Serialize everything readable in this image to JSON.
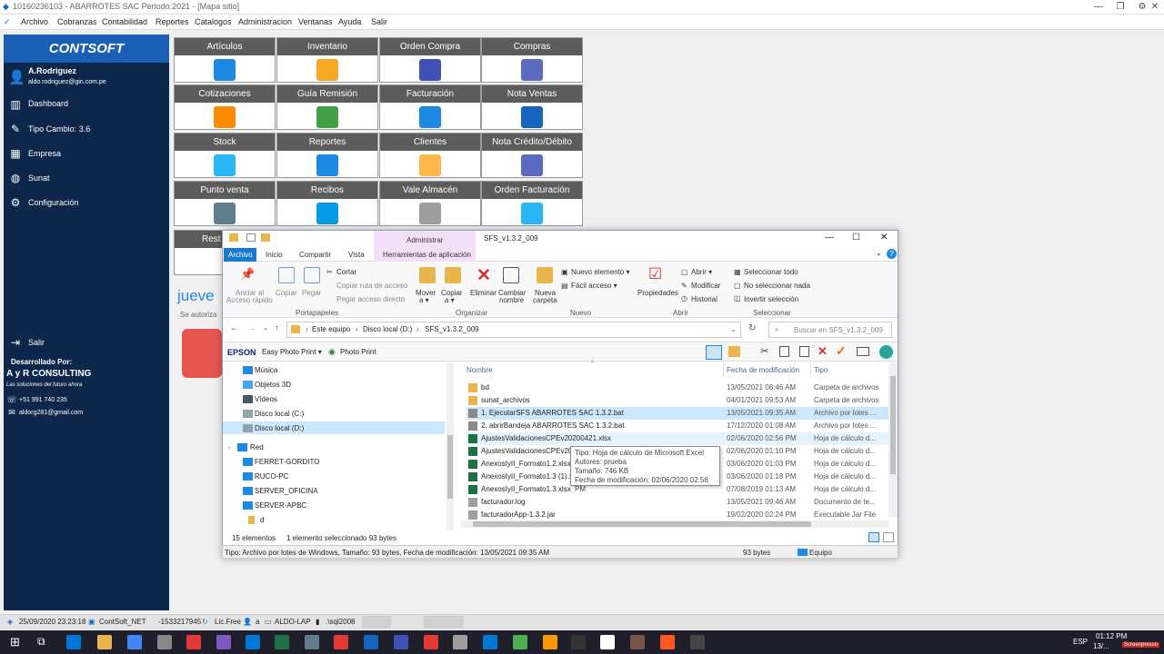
{
  "window": {
    "title": "10160236103 - ABARROTES SAC Periodo:2021 - [Mapa sitio]",
    "controls": [
      "—",
      "❐",
      "⚙",
      "✕"
    ]
  },
  "menu": [
    "Archivo",
    "Cobranzas",
    "Contabilidad",
    "Reportes",
    "Catalogos",
    "Administracion",
    "Ventanas",
    "Ayuda",
    "Salir"
  ],
  "sidebar": {
    "logo": "CONTSOFT",
    "user_name": "A.Rodriguez",
    "user_email": "aldo.rodriguez@gin.com.pe",
    "items": [
      "Dashboard",
      "Tipo Cambio: 3.6",
      "Empresa",
      "Sunat",
      "Configuración"
    ],
    "exit": "Salir",
    "dev_label": "Desarrollado Por:",
    "company": "A y R CONSULTING",
    "slogan": "Las soluciones del futuro ahora",
    "phone": "+51 991 740 235",
    "email": "aldorg281@gmail.com"
  },
  "tiles": [
    {
      "label": "Artículos",
      "color": "#1e88e5"
    },
    {
      "label": "Inventario",
      "color": "#f9a825"
    },
    {
      "label": "Orden Compra",
      "color": "#3f51b5"
    },
    {
      "label": "Compras",
      "color": "#5c6bc0"
    },
    {
      "label": "Cotizaciones",
      "color": "#fb8c00"
    },
    {
      "label": "Guía Remisión",
      "color": "#43a047"
    },
    {
      "label": "Facturación",
      "color": "#1e88e5"
    },
    {
      "label": "Nota Ventas",
      "color": "#1565c0"
    },
    {
      "label": "Stock",
      "color": "#29b6f6"
    },
    {
      "label": "Reportes",
      "color": "#1e88e5"
    },
    {
      "label": "Clientes",
      "color": "#ffb74d"
    },
    {
      "label": "Nota Crédito/Débito",
      "color": "#5c6bc0"
    },
    {
      "label": "Punto venta",
      "color": "#607d8b"
    },
    {
      "label": "Recibos",
      "color": "#039be5"
    },
    {
      "label": "Vale Almacén",
      "color": "#9e9e9e"
    },
    {
      "label": "Orden Facturación",
      "color": "#29b6f6"
    }
  ],
  "behind": {
    "tile_label": "Rest",
    "welcome": "jueve",
    "auth": "Se autoriza"
  },
  "explorer": {
    "title": "SFS_v1.3.2_009",
    "context_tab": "Administrar",
    "context_sub": "Herramientas de aplicación",
    "tabs": [
      "Archivo",
      "Inicio",
      "Compartir",
      "Vista"
    ],
    "ribbon": {
      "anclar": "Anclar al",
      "anclar2": "Acceso rápido",
      "copiar": "Copiar",
      "pegar": "Pegar",
      "cortar": "Cortar",
      "copiar_ruta": "Copiar ruta de acceso",
      "pegar_acceso": "Pegar acceso directo",
      "mover": "Mover",
      "mover2": "a ▾",
      "copiar_a": "Copiar",
      "copiar_a2": "a ▾",
      "eliminar": "Eliminar",
      "cambiar": "Cambiar",
      "cambiar2": "nombre",
      "nueva": "Nueva",
      "nueva2": "carpeta",
      "nuevo_elem": "Nuevo elemento ▾",
      "facil": "Fácil acceso ▾",
      "propiedades": "Propiedades",
      "abrir": "Abrir ▾",
      "modificar": "Modificar",
      "historial": "Historial",
      "sel_todo": "Seleccionar todo",
      "no_sel": "No seleccionar nada",
      "invertir": "Invertir selección"
    },
    "groups": [
      "Portapapeles",
      "Organizar",
      "Nuevo",
      "Abrir",
      "Seleccionar"
    ],
    "path": [
      "Este equipo",
      "Disco local (D:)",
      "SFS_v1.3.2_009"
    ],
    "search_placeholder": "Buscar en SFS_v1.3.2_009",
    "epson": "EPSON",
    "easy_photo": "Easy Photo Print ▾",
    "photo_print": "Photo Print",
    "nav": [
      "Música",
      "Objetos 3D",
      "Vídeos",
      "Disco local (C:)",
      "Disco local (D:)",
      "Red",
      "FERRET-GORDITO",
      "RUCO-PC",
      "SERVER_OFICINA",
      "SERVER-APBC",
      "d"
    ],
    "columns": [
      "Nombre",
      "Fecha de modificación",
      "Tipo"
    ],
    "files": [
      {
        "name": "bd",
        "date": "13/05/2021 08:46 AM",
        "type": "Carpeta de archivos",
        "c": "#e8b64a"
      },
      {
        "name": "sunat_archivos",
        "date": "04/01/2021 09:53 AM",
        "type": "Carpeta de archivos",
        "c": "#e8b64a"
      },
      {
        "name": "1. EjecutarSFS ABARROTES SAC 1.3.2.bat",
        "date": "13/05/2021 09:35 AM",
        "type": "Archivo por lotes ...",
        "c": "#8a8a8a"
      },
      {
        "name": "2. abrirBandeja ABARROTES SAC 1.3.2.bat",
        "date": "17/12/2020 01:08 AM",
        "type": "Archivo por lotes ...",
        "c": "#8a8a8a"
      },
      {
        "name": "AjustesValidacionesCPEv20200421.xlsx",
        "date": "02/06/2020 02:56 PM",
        "type": "Hoja de cálculo d...",
        "c": "#1e7145"
      },
      {
        "name": "AjustesValidacionesCPEv202",
        "date": "02/06/2020 01:10 PM",
        "type": "Hoja de cálculo d...",
        "c": "#1e7145"
      },
      {
        "name": "AnexosIyII_Formato1.2.xlsx",
        "date": "03/06/2020 01:03 PM",
        "type": "Hoja de cálculo d...",
        "c": "#1e7145"
      },
      {
        "name": "AnexosIyII_Formato1.3 (1).xl",
        "date": "03/06/2020 01:18 PM",
        "type": "Hoja de cálculo d...",
        "c": "#1e7145"
      },
      {
        "name": "AnexosIyII_Formato1.3.xlsx",
        "date": "07/08/2019 01:13 AM",
        "type": "Hoja de cálculo d...",
        "c": "#1e7145"
      },
      {
        "name": "facturador.log",
        "date": "13/05/2021 09:46 AM",
        "type": "Documento de te...",
        "c": "#9e9e9e"
      },
      {
        "name": "facturadorApp-1.3.2.jar",
        "date": "19/02/2020 02:24 PM",
        "type": "Executable Jar File",
        "c": "#9e9e9e"
      }
    ],
    "tooltip": [
      "Tipo: Hoja de cálculo de Microsoft Excel",
      "Autores: prueba",
      "Tamaño: 746 KB",
      "Fecha de modificación: 02/06/2020 02:56 PM"
    ],
    "count": "15 elementos",
    "selected": "1 elemento seleccionado  93 bytes",
    "details": "Tipo: Archivo por lotes de Windows, Tamaño: 93 bytes, Fecha de modificación: 13/05/2021 09:35 AM",
    "size": "93 bytes",
    "equipo": "Equipo"
  },
  "appstatus": [
    "25/09/2020 23:23:18",
    "ContSoft_NET",
    "-1533217945",
    "Lic.Free",
    "a",
    "ALDO-LAP",
    ".\\sql2008"
  ],
  "taskbar": {
    "lang": "ESP",
    "time": "01:12 PM",
    "date": "13/...",
    "watermark": "Screenpresso",
    "icons": [
      "#0078d7",
      "#e8b64a",
      "#4285f4",
      "#888",
      "#e53935",
      "#7e57c2",
      "#0078d7",
      "#1e7145",
      "#607d8b",
      "#e53935",
      "#1565c0",
      "#3f51b5",
      "#e53935",
      "#9e9e9e",
      "#0078d7",
      "#4caf50",
      "#ff9800",
      "#333",
      "#fff",
      "#795548",
      "#ff5722",
      "#444"
    ]
  }
}
